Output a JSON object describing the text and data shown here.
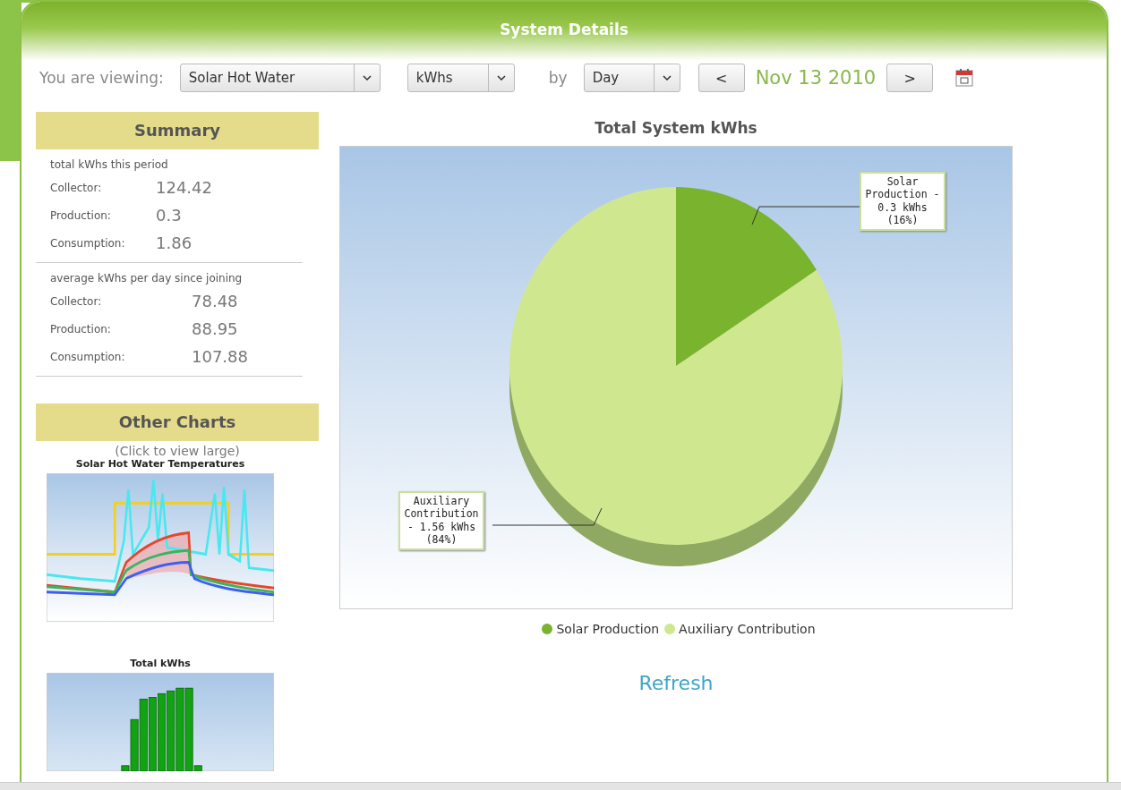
{
  "panel": {
    "title": "System Details"
  },
  "viewing": {
    "label": "You are viewing:",
    "system": "Solar Hot Water",
    "unit": "kWhs",
    "by_label": "by",
    "period": "Day",
    "prev": "<",
    "date": "Nov 13 2010",
    "next": ">"
  },
  "summary": {
    "title": "Summary",
    "sections": [
      {
        "heading": "total kWhs this period",
        "rows": [
          {
            "label": "Collector:",
            "value": "124.42"
          },
          {
            "label": "Production:",
            "value": "0.3"
          },
          {
            "label": "Consumption:",
            "value": "1.86"
          }
        ]
      },
      {
        "heading": "average kWhs per day since joining",
        "rows": [
          {
            "label": "Collector:",
            "value": "78.48"
          },
          {
            "label": "Production:",
            "value": "88.95"
          },
          {
            "label": "Consumption:",
            "value": "107.88"
          }
        ]
      }
    ]
  },
  "other_charts": {
    "title": "Other Charts",
    "hint": "(Click to view large)",
    "thumbnails": [
      {
        "title": "Solar Hot Water Temperatures",
        "kind": "line"
      },
      {
        "title": "Total kWhs",
        "kind": "bar"
      }
    ]
  },
  "main_chart": {
    "chart_data": {
      "type": "pie",
      "title": "Total System kWhs",
      "categories": [
        "Solar Production",
        "Auxiliary Contribution"
      ],
      "values": [
        16,
        84
      ],
      "colors": [
        "#7ab32e",
        "#cfe890"
      ],
      "annotations": [
        "Solar Production - 0.3 kWhs (16%)",
        "Auxiliary Contribution - 1.56 kWhs (84%)"
      ]
    }
  },
  "refresh": "Refresh"
}
